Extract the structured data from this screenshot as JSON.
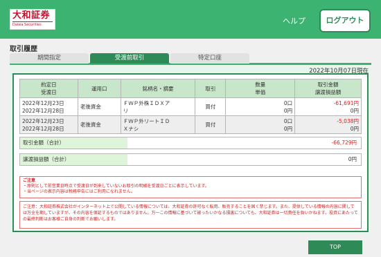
{
  "header": {
    "logo_jp": "大和証券",
    "logo_en": "Daiwa Securities",
    "help": "ヘルプ",
    "logout": "ログアウト"
  },
  "page": {
    "title": "取引履歴"
  },
  "tabs": [
    {
      "label": "期間指定",
      "active": false
    },
    {
      "label": "受渡前取引",
      "active": true
    },
    {
      "label": "特定口座",
      "active": false
    }
  ],
  "as_of": "2022年10月07日現在",
  "table": {
    "headers": {
      "date1": "約定日",
      "date2": "受渡日",
      "account": "運用口",
      "name": "銘柄名・摘要",
      "type": "取引",
      "qty1": "数量",
      "qty2": "単価",
      "amt1": "取引金額",
      "amt2": "譲渡損益額"
    },
    "rows": [
      {
        "trade_date": "2022年12月23日",
        "settle_date": "2022年12月28日",
        "account": "老後資金",
        "name_line1": "ＦＷＰ外株ＩＤＸア",
        "name_line2": "リ",
        "type": "買付",
        "qty": "0口",
        "price": "0円",
        "amount": "-61,691円",
        "gain": "0円"
      },
      {
        "trade_date": "2022年12月23日",
        "settle_date": "2022年12月28日",
        "account": "老後資金",
        "name_line1": "ＦＷＰ外リートＩＤ",
        "name_line2": "Ｘナシ",
        "type": "買付",
        "qty": "0口",
        "price": "0円",
        "amount": "-5,038円",
        "gain": "0円"
      }
    ]
  },
  "summary": {
    "total_amount_label": "取引金額（合計）",
    "total_amount": "-66,729円",
    "total_gain_label": "譲渡損益額（合計）",
    "total_gain": "0円"
  },
  "notice": {
    "title": "ご注意",
    "line1": "・原則として前営業日時点で受渡日が到来していないお取引の明細を受渡日ごとに表示しています。",
    "line2": "・当ページの表示内容は税務申告にはご利用になれません。"
  },
  "disclaimer": "ご注意：大和証券株式会社がインターネット上で公開している情報については、大和証券の許可なく転用、販売することを固く禁じます。また、提供している情報の内容に関しては万全を期していますが、その内容を保証するものではありません。万一この情報に基づいて被ったいかなる損害についても、大和証券は一切責任を負いかねます。投資にあたっての最終判断はお客様ご自身の判断でお願いします。",
  "footer": {
    "top": "TOP"
  },
  "colors": {
    "brand_green": "#3cb371",
    "dark_green": "#2e8b57",
    "negative": "#e02020",
    "logo_red": "#c8102e"
  }
}
